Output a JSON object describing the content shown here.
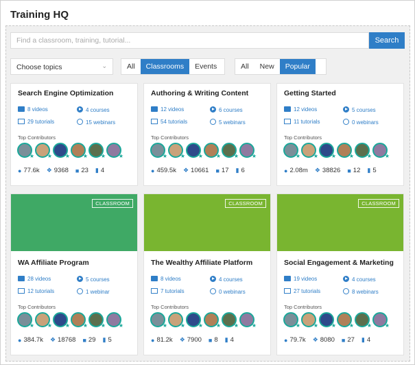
{
  "page_title": "Training HQ",
  "search": {
    "placeholder": "Find a classroom, training, tutorial...",
    "button": "Search"
  },
  "filters": {
    "topics_label": "Choose topics",
    "type_options": [
      "All",
      "Classrooms",
      "Events"
    ],
    "type_active": 1,
    "sort_options": [
      "All",
      "New",
      "Popular"
    ],
    "sort_active": 2
  },
  "contributors_label": "Top Contributors",
  "badge_label": "CLASSROOM",
  "colors": {
    "accent": "#2f7ec7",
    "green_dark": "#3fa965",
    "green_light": "#79b530",
    "teal": "#1aa89a"
  },
  "cards": [
    {
      "title": "Search Engine Optimization",
      "videos": "8 videos",
      "courses": "4 courses",
      "tutorials": "29 tutorials",
      "webinars": "15 webinars",
      "views": "77.6k",
      "comments": "9368",
      "likes": "23",
      "bookmarks": "4",
      "banner": false
    },
    {
      "title": "Authoring & Writing Content",
      "videos": "12 videos",
      "courses": "6 courses",
      "tutorials": "54 tutorials",
      "webinars": "5 webinars",
      "views": "459.5k",
      "comments": "10661",
      "likes": "17",
      "bookmarks": "6",
      "banner": false
    },
    {
      "title": "Getting Started",
      "videos": "12 videos",
      "courses": "5 courses",
      "tutorials": "11 tutorials",
      "webinars": "0 webinars",
      "views": "2.08m",
      "comments": "38826",
      "likes": "12",
      "bookmarks": "5",
      "banner": false
    },
    {
      "title": "WA Affiliate Program",
      "videos": "28 videos",
      "courses": "5 courses",
      "tutorials": "12 tutorials",
      "webinars": "1 webinar",
      "views": "384.7k",
      "comments": "18768",
      "likes": "29",
      "bookmarks": "5",
      "banner": true,
      "banner_color": "#3fa965"
    },
    {
      "title": "The Wealthy Affiliate Platform",
      "videos": "8 videos",
      "courses": "4 courses",
      "tutorials": "7 tutorials",
      "webinars": "0 webinars",
      "views": "81.2k",
      "comments": "7900",
      "likes": "8",
      "bookmarks": "4",
      "banner": true,
      "banner_color": "#79b530"
    },
    {
      "title": "Social Engagement & Marketing",
      "videos": "19 videos",
      "courses": "4 courses",
      "tutorials": "27 tutorials",
      "webinars": "8 webinars",
      "views": "79.7k",
      "comments": "8080",
      "likes": "27",
      "bookmarks": "4",
      "banner": true,
      "banner_color": "#79b530"
    }
  ],
  "avatar_colors": [
    "#7a8f99",
    "#c9a27a",
    "#2e4a8a",
    "#b08058",
    "#5c6f4d",
    "#8f7aa0"
  ]
}
